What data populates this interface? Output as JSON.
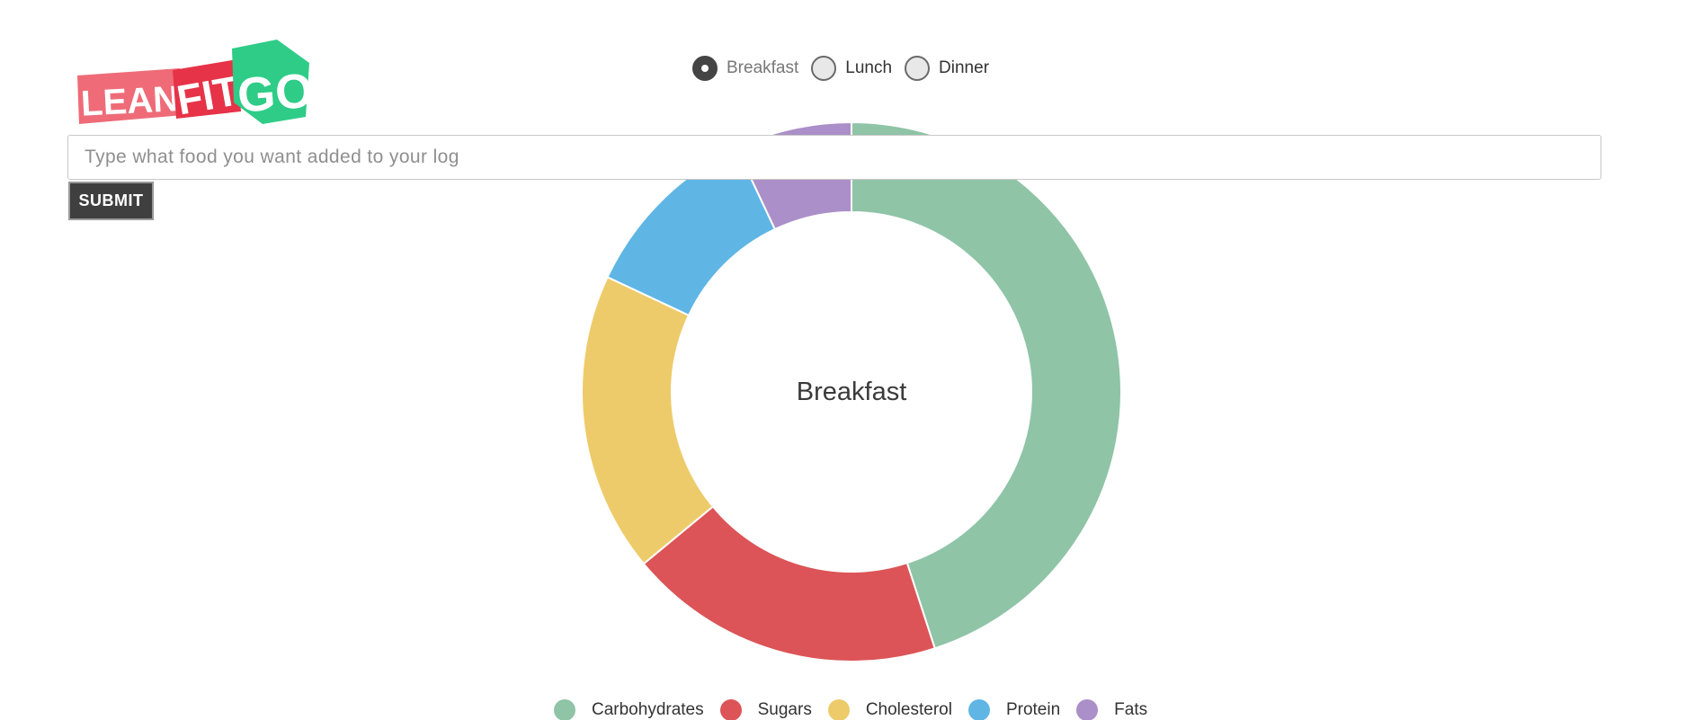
{
  "logo": {
    "text_lean": "LEAN",
    "text_fit": "FIT",
    "text_go": "GO",
    "colors": {
      "lean": "#ef6b78",
      "fit": "#e63348",
      "go": "#2ecc87"
    }
  },
  "meal_selector": {
    "options": [
      {
        "label": "Breakfast",
        "checked": true
      },
      {
        "label": "Lunch",
        "checked": false
      },
      {
        "label": "Dinner",
        "checked": false
      }
    ]
  },
  "search": {
    "placeholder": "Type what food you want added to your log",
    "value": ""
  },
  "submit": {
    "label": "SUBMIT"
  },
  "chart_data": {
    "type": "pie",
    "title": "Breakfast",
    "categories": [
      "Carbohydrates",
      "Sugars",
      "Cholesterol",
      "Protein",
      "Fats"
    ],
    "values": [
      45,
      19,
      18,
      11,
      7
    ],
    "colors": [
      "#8fc4a7",
      "#dc5457",
      "#eecb6a",
      "#5fb6e5",
      "#ab8fc8"
    ],
    "legend_position": "bottom"
  }
}
